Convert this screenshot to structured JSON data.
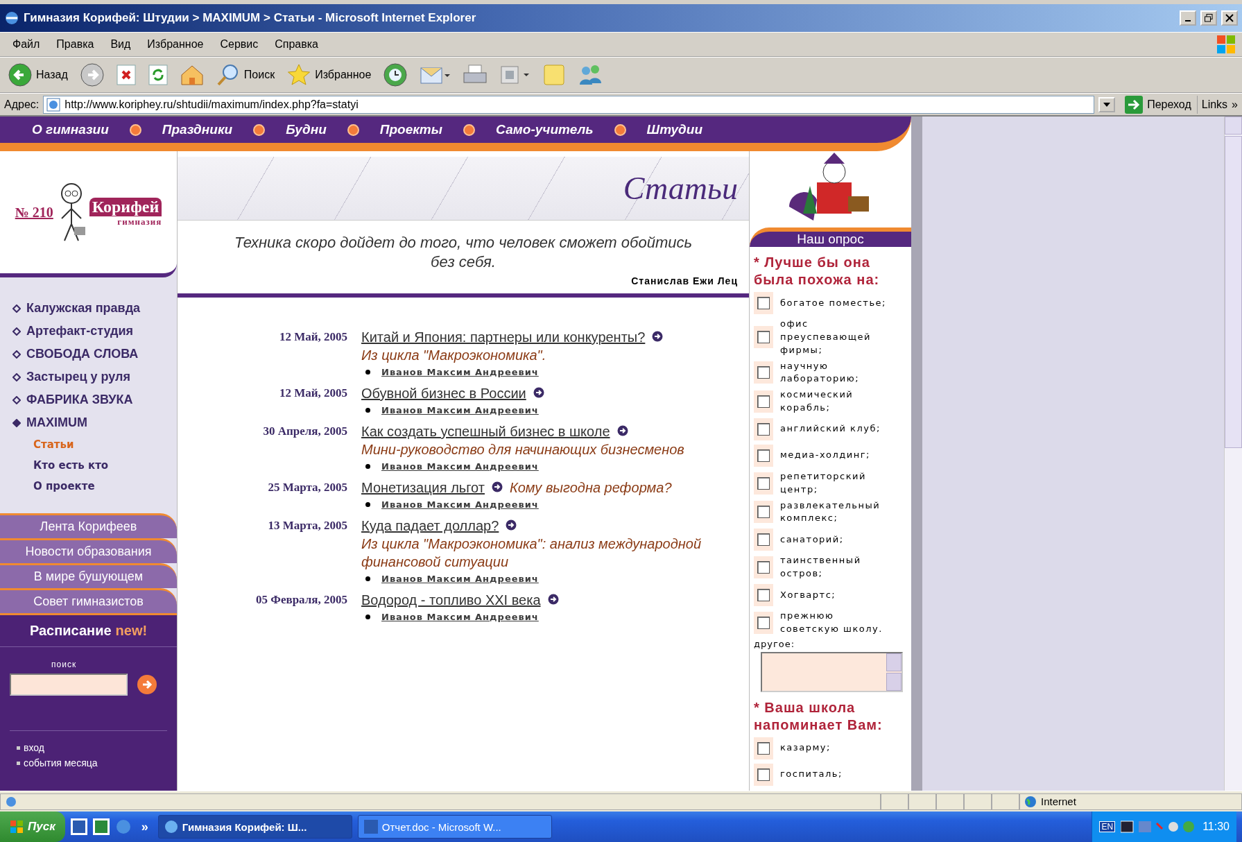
{
  "window": {
    "title": "Гимназия Корифей: Штудии > MAXIMUM > Статьи - Microsoft Internet Explorer"
  },
  "menu": [
    "Файл",
    "Правка",
    "Вид",
    "Избранное",
    "Сервис",
    "Справка"
  ],
  "toolbar": [
    {
      "kind": "back",
      "label": "Назад"
    },
    {
      "kind": "forward"
    },
    {
      "kind": "stop"
    },
    {
      "kind": "refresh"
    },
    {
      "kind": "home"
    },
    {
      "kind": "search",
      "label": "Поиск"
    },
    {
      "kind": "favorites",
      "label": "Избранное"
    },
    {
      "kind": "history"
    },
    {
      "kind": "mail"
    },
    {
      "kind": "print"
    },
    {
      "kind": "edit"
    },
    {
      "kind": "note"
    },
    {
      "kind": "messenger"
    }
  ],
  "address": {
    "label": "Адрес:",
    "url": "http://www.koriphey.ru/shtudii/maximum/index.php?fa=statyi",
    "go": "Переход",
    "links": "Links",
    "more": "»"
  },
  "nav": [
    "О гимназии",
    "Праздники",
    "Будни",
    "Проекты",
    "Само-учитель",
    "Штудии"
  ],
  "logo": {
    "number": "№ 210",
    "name": "Корифей",
    "subtitle": "гимназия"
  },
  "header": {
    "title": "Статьи",
    "quote": "Техника скоро дойдет до того, что человек сможет обойтись без себя.",
    "author": "Станислав Ежи Лец"
  },
  "sidebar": {
    "sections": [
      {
        "label": "Калужская правда",
        "expanded": false
      },
      {
        "label": "Артефакт-студия",
        "expanded": false
      },
      {
        "label": "СВОБОДА СЛОВА",
        "expanded": false
      },
      {
        "label": "Застырец у руля",
        "expanded": false
      },
      {
        "label": "ФАБРИКА ЗВУКА",
        "expanded": false
      },
      {
        "label": "MAXIMUM",
        "expanded": true,
        "children": [
          {
            "label": "Статьи",
            "selected": true
          },
          {
            "label": "Кто есть кто",
            "selected": false
          },
          {
            "label": "О проекте",
            "selected": false
          }
        ]
      }
    ],
    "tabs": [
      "Лента Корифеев",
      "Новости образования",
      "В мире бушующем",
      "Совет гимназистов"
    ],
    "schedule": {
      "label": "Расписание",
      "badge": "new!"
    },
    "search_label": "поиск",
    "links": [
      "вход",
      "события месяца"
    ]
  },
  "articles": [
    {
      "date": "12 Май, 2005",
      "title": "Китай и Япония: партнеры или конкуренты?",
      "note": "Из цикла \"Макроэкономика\".",
      "author": "Иванов Максим Андреевич"
    },
    {
      "date": "12 Май, 2005",
      "title": "Обувной бизнес в России",
      "author": "Иванов Максим Андреевич"
    },
    {
      "date": "30 Апреля, 2005",
      "title": "Как создать успешный бизнес в школе",
      "note": "Мини-руководство для начинающих бизнесменов",
      "author": "Иванов Максим Андреевич"
    },
    {
      "date": "25 Марта, 2005",
      "title": "Монетизация льгот",
      "note": "Кому выгодна реформа?",
      "author": "Иванов Максим Андреевич"
    },
    {
      "date": "13 Марта, 2005",
      "title": "Куда падает доллар?",
      "note": "Из цикла \"Макроэкономика\": анализ международной финансовой ситуации",
      "author": "Иванов Максим Андреевич"
    },
    {
      "date": "05 Февраля, 2005",
      "title": "Водород - топливо XXI века",
      "author": "Иванов Максим Андреевич"
    }
  ],
  "poll": {
    "title": "Наш опрос",
    "questions": [
      {
        "text": "* Лучше бы она была похожа на:",
        "other_label": "другое:",
        "options": [
          {
            "label": "богатое поместье;",
            "checked": false
          },
          {
            "label": "офис преуспевающей фирмы;",
            "checked": false
          },
          {
            "label": "научную лабораторию;",
            "checked": false
          },
          {
            "label": "космический корабль;",
            "checked": false
          },
          {
            "label": "английский клуб;",
            "checked": false
          },
          {
            "label": "медиа-холдинг;",
            "checked": false
          },
          {
            "label": "репетиторский центр;",
            "checked": false
          },
          {
            "label": "развлекательный комплекс;",
            "checked": false
          },
          {
            "label": "санаторий;",
            "checked": false
          },
          {
            "label": "таинственный остров;",
            "checked": false
          },
          {
            "label": "Хогвартс;",
            "checked": false
          },
          {
            "label": "прежнюю советскую школу.",
            "checked": false
          }
        ]
      },
      {
        "text": "* Ваша школа напоминает Вам:",
        "options": [
          {
            "label": "казарму;",
            "checked": false
          },
          {
            "label": "госпиталь;",
            "checked": false
          }
        ]
      }
    ]
  },
  "status_bar": {
    "zone": "Internet"
  },
  "taskbar": {
    "start": "Пуск",
    "more": "»",
    "tasks": [
      {
        "label": "Гимназия Корифей: Ш...",
        "selected": true,
        "kind": "browser"
      },
      {
        "label": "Отчет.doc - Microsoft W...",
        "selected": false,
        "kind": "word"
      }
    ],
    "language": "EN",
    "clock": "11:30"
  }
}
